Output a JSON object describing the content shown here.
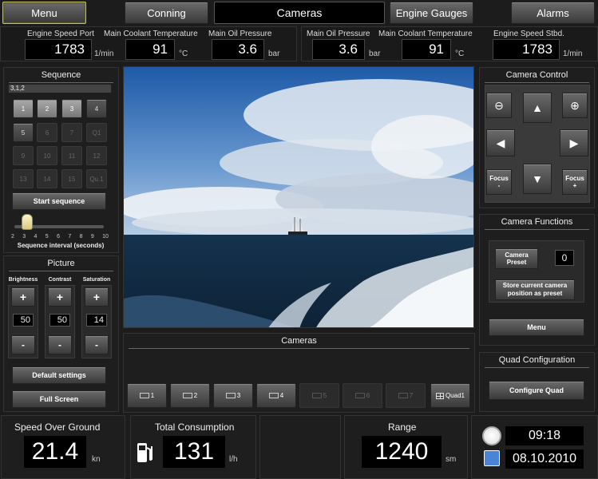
{
  "nav": {
    "menu": "Menu",
    "conning": "Conning",
    "cameras": "Cameras",
    "engine_gauges": "Engine Gauges",
    "alarms": "Alarms"
  },
  "gauges": [
    {
      "label": "Engine Speed Port",
      "value": "1783",
      "unit": "1/min"
    },
    {
      "label": "Main Coolant Temperature",
      "value": "91",
      "unit": "°C"
    },
    {
      "label": "Main Oil Pressure",
      "value": "3.6",
      "unit": "bar"
    },
    {
      "label": "Main Oil Pressure",
      "value": "3.6",
      "unit": "bar"
    },
    {
      "label": "Main Coolant Temperature",
      "value": "91",
      "unit": "°C"
    },
    {
      "label": "Engine Speed Stbd.",
      "value": "1783",
      "unit": "1/min"
    }
  ],
  "sequence": {
    "title": "Sequence",
    "field": "3,1,2",
    "buttons": [
      "1",
      "2",
      "3",
      "4",
      "5",
      "6",
      "7",
      "Q1",
      "9",
      "10",
      "11",
      "12",
      "13",
      "14",
      "15",
      "Qu.1"
    ],
    "start": "Start sequence",
    "ticks": [
      "2",
      "3",
      "4",
      "5",
      "6",
      "7",
      "8",
      "9",
      "10"
    ],
    "interval_label": "Sequence interval (seconds)",
    "interval_value": 2
  },
  "picture": {
    "title": "Picture",
    "controls": [
      {
        "label": "Brightness",
        "value": "50"
      },
      {
        "label": "Contrast",
        "value": "50"
      },
      {
        "label": "Saturation",
        "value": "14"
      }
    ],
    "plus": "+",
    "minus": "-",
    "default": "Default settings",
    "fullscreen": "Full Screen"
  },
  "cameras_strip": {
    "title": "Cameras",
    "items": [
      "1",
      "2",
      "3",
      "4",
      "5",
      "6",
      "7",
      "Quad1"
    ]
  },
  "camera_control": {
    "title": "Camera Control",
    "focus_minus": "Focus -",
    "focus_plus": "Focus +"
  },
  "camera_functions": {
    "title": "Camera Functions",
    "preset": "Camera Preset",
    "preset_value": "0",
    "store": "Store current camera position as preset",
    "menu": "Menu"
  },
  "quad": {
    "title": "Quad Configuration",
    "configure": "Configure Quad"
  },
  "bottom": {
    "sog_label": "Speed Over Ground",
    "sog_value": "21.4",
    "sog_unit": "kn",
    "tc_label": "Total Consumption",
    "tc_value": "131",
    "tc_unit": "l/h",
    "range_label": "Range",
    "range_value": "1240",
    "range_unit": "sm",
    "time": "09:18",
    "date": "08.10.2010"
  },
  "colors": {
    "accent": "#c8c060",
    "panel": "#1e1e1e",
    "value_bg": "#000000"
  }
}
